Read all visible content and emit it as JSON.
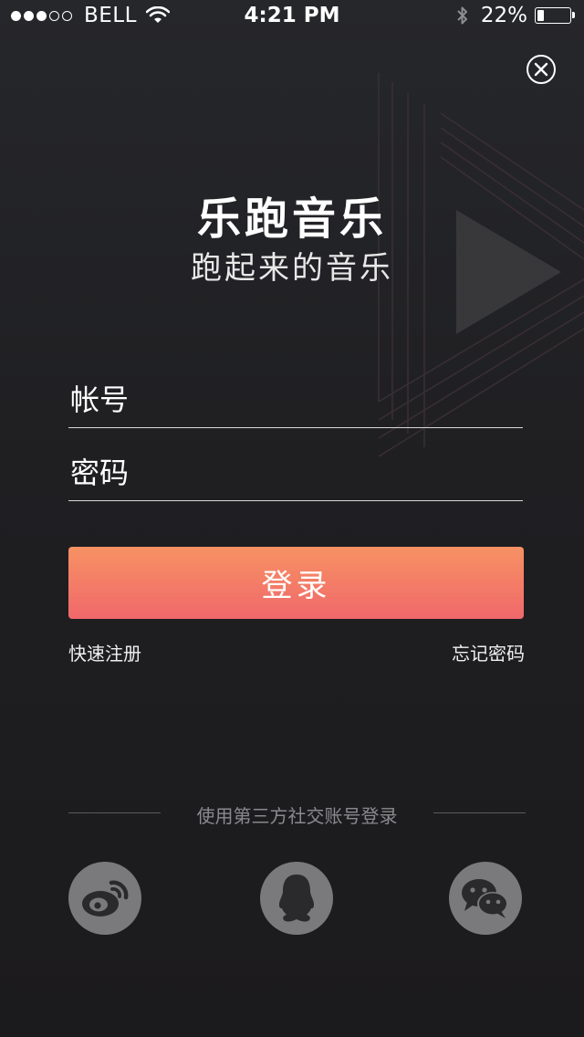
{
  "status_bar": {
    "carrier": "BELL",
    "signal_bars_filled": 3,
    "signal_bars_total": 5,
    "time": "4:21 PM",
    "battery_percent": "22%",
    "battery_level": 0.22,
    "icons": [
      "signal-dots",
      "wifi-icon",
      "bluetooth-icon",
      "battery-icon"
    ]
  },
  "header": {
    "close_icon": "close-icon",
    "app_title": "乐跑音乐",
    "slogan": "跑起来的音乐"
  },
  "form": {
    "account_placeholder": "帐号",
    "account_value": "",
    "password_placeholder": "密码",
    "password_value": "",
    "login_label": "登录",
    "register_link": "快速注册",
    "forgot_link": "忘记密码"
  },
  "third_party": {
    "label": "使用第三方社交账号登录",
    "providers": [
      "weibo-icon",
      "qq-icon",
      "wechat-icon"
    ]
  },
  "colors": {
    "background": "#1f1f22",
    "login_gradient_top": "#f79263",
    "login_gradient_bottom": "#f0686b",
    "social_button": "#7a7a7c",
    "social_glyph": "#2a2a2c"
  }
}
